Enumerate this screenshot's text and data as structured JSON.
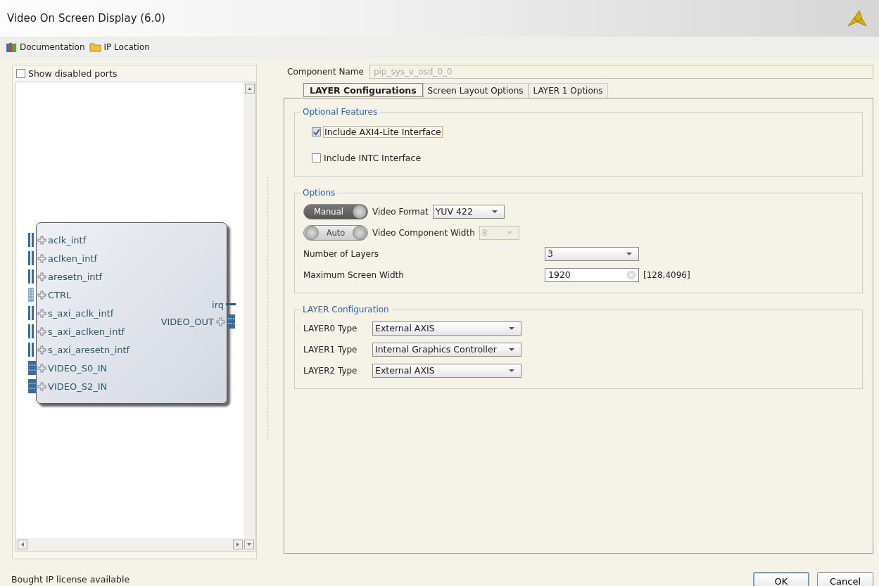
{
  "window": {
    "title": "Video On Screen Display (6.0)"
  },
  "toolbar": [
    {
      "label": "Documentation",
      "kind": "book"
    },
    {
      "label": "IP Location",
      "kind": "folder"
    }
  ],
  "symbol_panel": {
    "show_disabled_ports": {
      "label": "Show disabled ports",
      "checked": false
    },
    "block": {
      "inputs": [
        {
          "name": "aclk_intf",
          "kind": "wire"
        },
        {
          "name": "aclken_intf",
          "kind": "wire"
        },
        {
          "name": "aresetn_intf",
          "kind": "wire"
        },
        {
          "name": "CTRL",
          "kind": "bus"
        },
        {
          "name": "s_axi_aclk_intf",
          "kind": "wire"
        },
        {
          "name": "s_axi_aclken_intf",
          "kind": "wire"
        },
        {
          "name": "s_axi_aresetn_intf",
          "kind": "wire"
        },
        {
          "name": "VIDEO_S0_IN",
          "kind": "stream"
        },
        {
          "name": "VIDEO_S2_IN",
          "kind": "stream"
        }
      ],
      "outputs": [
        {
          "name": "irq",
          "kind": "line"
        },
        {
          "name": "VIDEO_OUT",
          "kind": "stream"
        }
      ]
    }
  },
  "component_name": {
    "label": "Component Name",
    "value": "pip_sys_v_osd_0_0",
    "disabled": true
  },
  "tabs": [
    {
      "label": "LAYER Configurations",
      "selected": true
    },
    {
      "label": "Screen Layout Options",
      "selected": false
    },
    {
      "label": "LAYER 1 Options",
      "selected": false
    }
  ],
  "sections": [
    {
      "title": "Optional Features",
      "rows": [
        {
          "kind": "checkbox",
          "label": "Include AXI4-Lite Interface",
          "checked": true,
          "focused": true
        },
        {
          "kind": "checkbox",
          "label": "Include INTC Interface",
          "checked": false,
          "focused": false
        }
      ]
    },
    {
      "title": "Options",
      "rows": [
        {
          "kind": "toggle-select",
          "toggle": "Manual",
          "on": true,
          "label": "Video Format",
          "value": "YUV 422",
          "disabled": false
        },
        {
          "kind": "toggle-select",
          "toggle": "Auto",
          "on": false,
          "label": "Video Component Width",
          "value": "8",
          "disabled": true
        },
        {
          "kind": "select",
          "label": "Number of Layers",
          "value": "3"
        },
        {
          "kind": "input",
          "label": "Maximum Screen Width",
          "value": "1920",
          "range": "[128,4096]"
        }
      ]
    },
    {
      "title": "LAYER Configuration",
      "rows": [
        {
          "kind": "type-select",
          "label": "LAYER0 Type",
          "value": "External AXIS"
        },
        {
          "kind": "type-select",
          "label": "LAYER1 Type",
          "value": "Internal Graphics Controller"
        },
        {
          "kind": "type-select",
          "label": "LAYER2 Type",
          "value": "External AXIS"
        }
      ]
    }
  ],
  "status": "Bought IP license available",
  "buttons": [
    {
      "label": "OK",
      "default": true
    },
    {
      "label": "Cancel",
      "default": false
    }
  ]
}
